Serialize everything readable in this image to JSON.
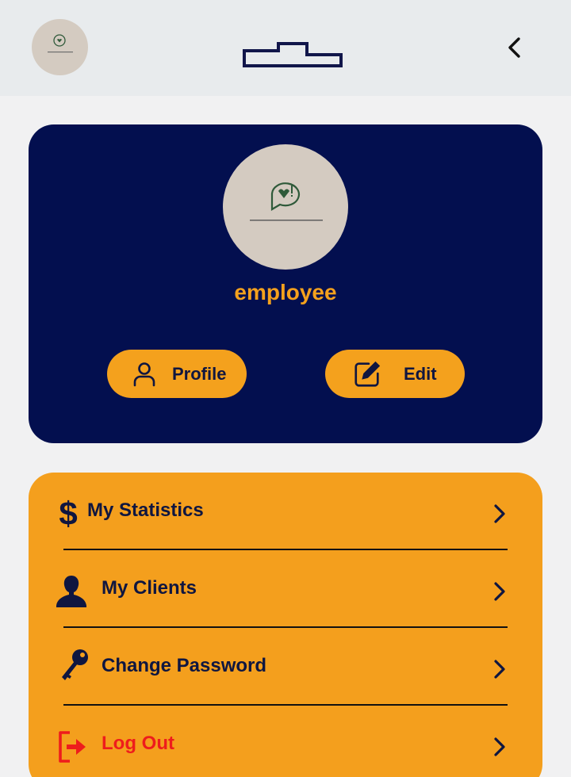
{
  "header": {
    "avatar_icon": "profile-picture",
    "logo_icon": "app-logo",
    "back_icon": "chevron-left-icon"
  },
  "profile": {
    "username": "employee",
    "profile_button_label": "Profile",
    "edit_button_label": "Edit"
  },
  "menu": {
    "items": [
      {
        "label": "My Statistics",
        "icon": "dollar-icon"
      },
      {
        "label": "My Clients",
        "icon": "user-silhouette-icon"
      },
      {
        "label": "Change Password",
        "icon": "key-icon"
      },
      {
        "label": "Log Out",
        "icon": "logout-icon"
      }
    ]
  },
  "colors": {
    "navy": "#030f4f",
    "accent": "#f4a11d",
    "logout": "#ee1c1c",
    "header_bg": "#e8ebed",
    "page_bg": "#f1f1f2"
  }
}
